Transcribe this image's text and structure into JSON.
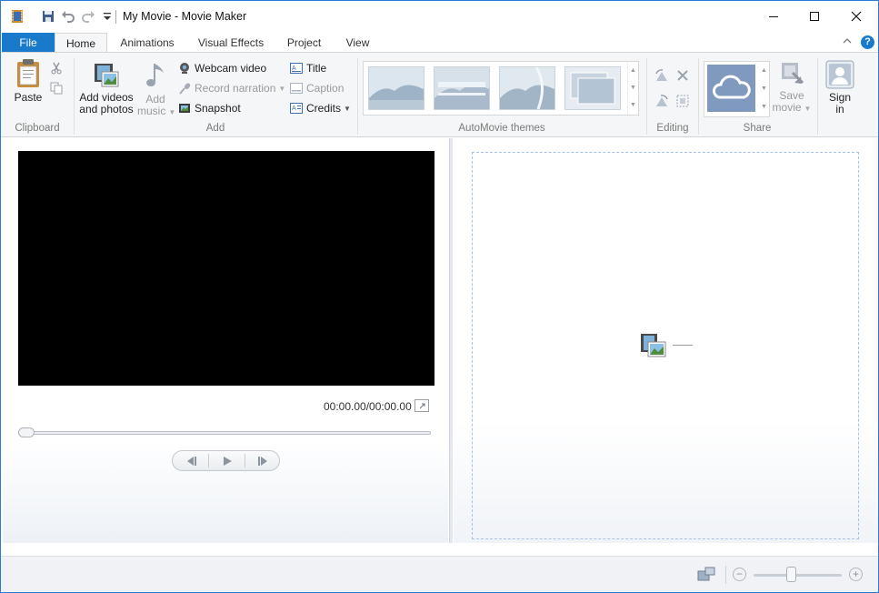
{
  "window": {
    "title": "My Movie - Movie Maker"
  },
  "tabs": {
    "file": "File",
    "items": [
      "Home",
      "Animations",
      "Visual Effects",
      "Project",
      "View"
    ],
    "active": "Home",
    "help": "?"
  },
  "ribbon": {
    "clipboard": {
      "label": "Clipboard",
      "paste": "Paste"
    },
    "add": {
      "label": "Add",
      "add_videos_line1": "Add videos",
      "add_videos_line2": "and photos",
      "add_music_line1": "Add",
      "add_music_line2": "music",
      "webcam_video": "Webcam video",
      "record_narration": "Record narration",
      "snapshot": "Snapshot",
      "title": "Title",
      "caption": "Caption",
      "credits": "Credits"
    },
    "automovie": {
      "label": "AutoMovie themes"
    },
    "editing": {
      "label": "Editing"
    },
    "share": {
      "label": "Share",
      "save_movie_line1": "Save",
      "save_movie_line2": "movie",
      "sign_in_line1": "Sign",
      "sign_in_line2": "in"
    }
  },
  "preview": {
    "time": "00:00.00/00:00.00"
  },
  "colors": {
    "accent": "#1979ca",
    "window_border": "#2b79d8",
    "share_thumb": "#7f99bf"
  },
  "icons": [
    "movie-maker-app-icon",
    "save-icon",
    "undo-icon",
    "redo-icon",
    "customize-qat-icon",
    "minimize-icon",
    "maximize-icon",
    "close-icon",
    "help-icon",
    "ribbon-collapse-icon",
    "paste-icon",
    "cut-icon",
    "copy-icon",
    "film-photo-icon",
    "music-note-icon",
    "webcam-icon",
    "microphone-icon",
    "snapshot-icon",
    "title-icon",
    "caption-icon",
    "credits-icon",
    "rotate-left-icon",
    "rotate-right-icon",
    "remove-icon",
    "select-all-icon",
    "onedrive-cloud-icon",
    "save-movie-icon",
    "sign-in-icon",
    "expand-preview-icon",
    "previous-frame-icon",
    "play-icon",
    "next-frame-icon",
    "storyboard-add-icon",
    "thumbnail-size-icon",
    "zoom-out-icon",
    "zoom-in-icon"
  ]
}
